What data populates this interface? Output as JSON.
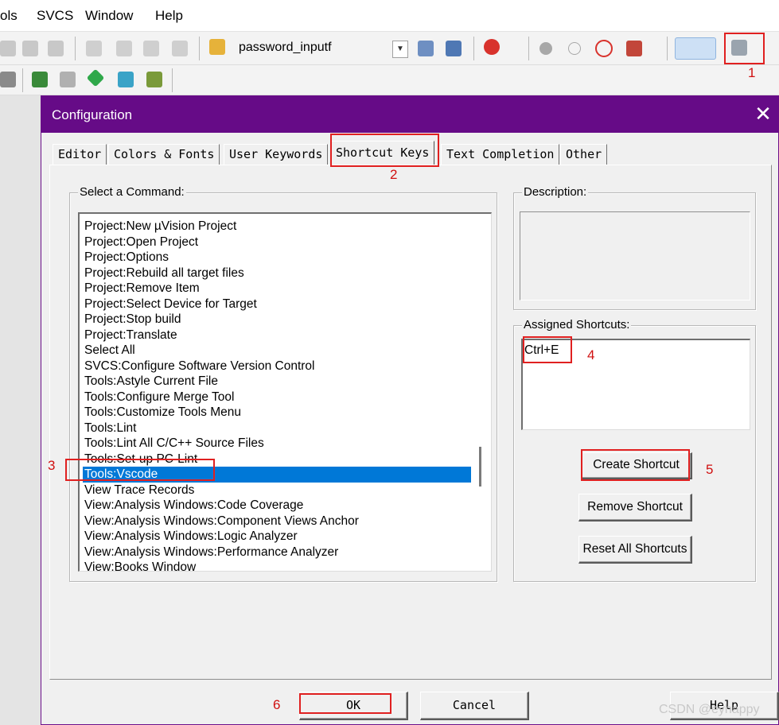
{
  "menubar": {
    "items": [
      "ols",
      "SVCS",
      "Window",
      "Help"
    ]
  },
  "toolbar": {
    "target_combo": "password_inputf"
  },
  "dialog": {
    "title": "Configuration",
    "close_glyph": "✕",
    "tabs": [
      "Editor",
      "Colors & Fonts",
      "User Keywords",
      "Shortcut Keys",
      "Text Completion",
      "Other"
    ],
    "active_tab": "Shortcut Keys",
    "select_command_label": "Select a Command:",
    "commands": [
      "Project:New µVision Project",
      "Project:Open Project",
      "Project:Options",
      "Project:Rebuild all target files",
      "Project:Remove Item",
      "Project:Select Device for Target",
      "Project:Stop build",
      "Project:Translate",
      "Select All",
      "SVCS:Configure Software Version Control",
      "Tools:Astyle Current File",
      "Tools:Configure Merge Tool",
      "Tools:Customize Tools Menu",
      "Tools:Lint",
      "Tools:Lint All C/C++ Source Files",
      "Tools:Set-up PC-Lint",
      "Tools:Vscode",
      "View Trace Records",
      "View:Analysis Windows:Code Coverage",
      "View:Analysis Windows:Component Views Anchor",
      "View:Analysis Windows:Logic Analyzer",
      "View:Analysis Windows:Performance Analyzer",
      "View:Books Window"
    ],
    "selected_command": "Tools:Vscode",
    "description_label": "Description:",
    "assigned_label": "Assigned Shortcuts:",
    "assigned_shortcut": "Ctrl+E",
    "buttons": {
      "create": "Create Shortcut",
      "remove": "Remove Shortcut",
      "reset": "Reset All Shortcuts",
      "ok": "OK",
      "cancel": "Cancel",
      "help": "Help"
    }
  },
  "annotations": [
    "1",
    "2",
    "3",
    "4",
    "5",
    "6"
  ],
  "watermark": "CSDN @eyhappy",
  "colors": {
    "titlebar": "#660b87",
    "selection": "#0078d7",
    "annotation": "#e02020"
  }
}
